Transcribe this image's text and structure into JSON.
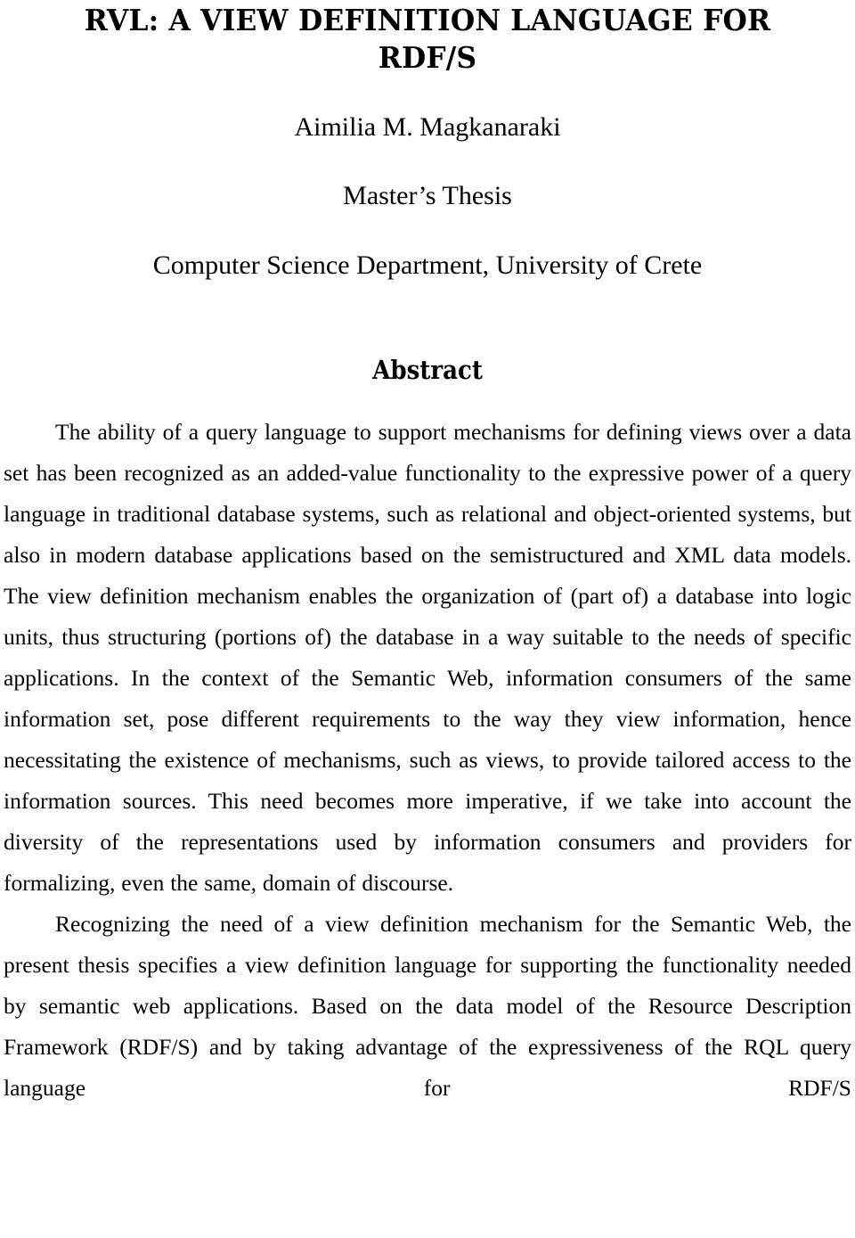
{
  "document": {
    "title_lines": [
      "RVL: A VIEW DEFINITION LANGUAGE FOR",
      "RDF/S"
    ],
    "author": "Aimilia M. Magkanaraki",
    "thesis_type": "Master’s Thesis",
    "department": "Computer Science Department, University of Crete",
    "abstract_heading": "Abstract",
    "abstract_paragraphs": [
      "The ability of a query language to support mechanisms for defining views over a data set has been recognized as an added-value functionality to the expressive power of a query language in traditional database systems, such as relational and object-oriented systems, but also in modern database applications based on the semistructured and XML data models. The view definition mechanism enables the organization of (part of) a database into logic units, thus structuring (portions of) the database in a way suitable to the needs of specific applications. In the context of the Semantic Web, information consumers of the same information set, pose different requirements to the way they view information, hence necessitating the existence of mechanisms, such as views, to provide tailored access to the information sources. This need becomes more imperative, if we take into account the diversity of the representations used by information consumers and providers for formalizing, even the same, domain of discourse.",
      "Recognizing the need of a view definition mechanism for the Semantic Web, the present thesis specifies a view definition language for supporting the functionality needed by semantic web applications. Based on the data model of the Resource Description Framework (RDF/S) and by taking advantage of the expressiveness of the RQL query language for RDF/S"
    ],
    "colors": {
      "background": "#ffffff",
      "text": "#000000"
    }
  }
}
